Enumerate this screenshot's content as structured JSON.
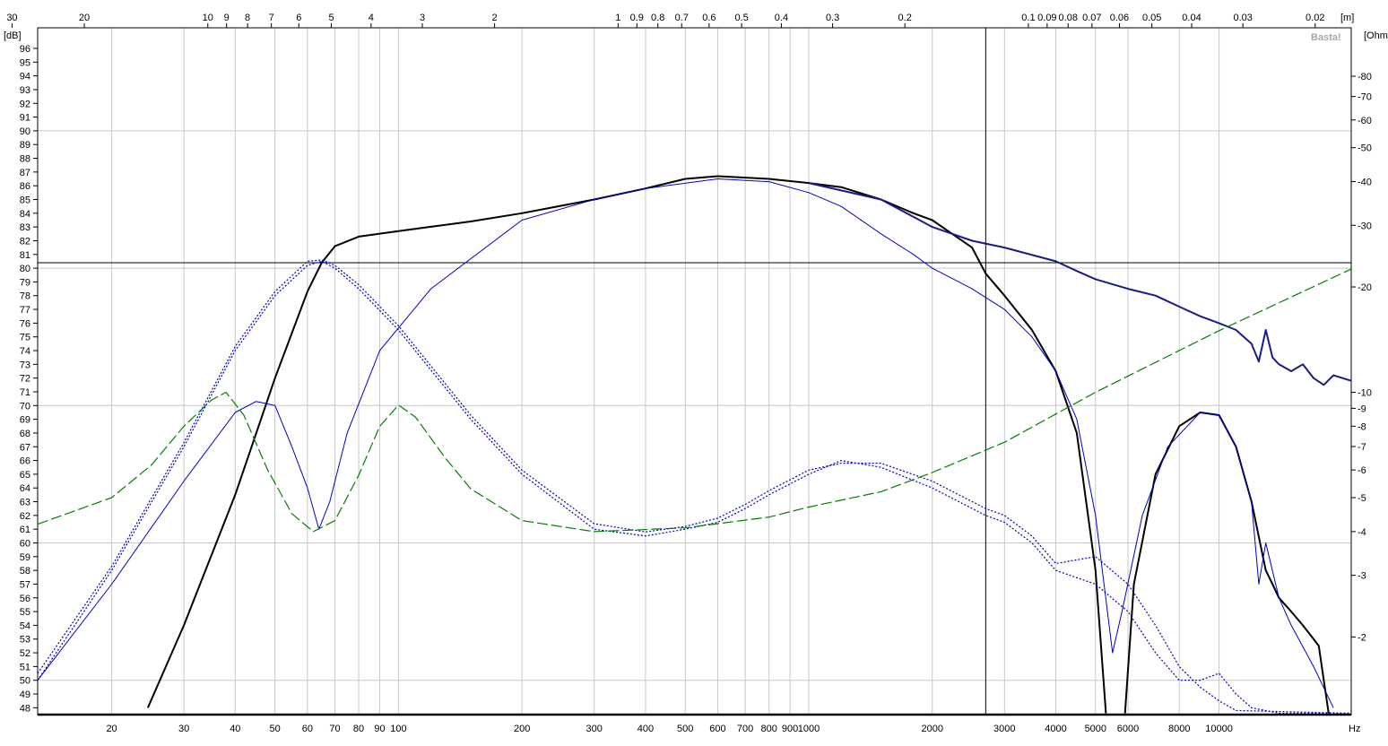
{
  "chart_data": {
    "type": "line",
    "x_scale": "log",
    "xlim": [
      13.2,
      21000
    ],
    "ylim": [
      47.5,
      97.5
    ],
    "grid": true,
    "left_axis_unit": "[dB]",
    "right_axis_unit": "[Ohm]",
    "top_axis_unit": "[m]",
    "bottom_axis_unit": "Hz",
    "watermark": "Basta!",
    "left_ticks": [
      48,
      49,
      50,
      51,
      52,
      53,
      54,
      55,
      56,
      57,
      58,
      59,
      60,
      61,
      62,
      63,
      64,
      65,
      66,
      67,
      68,
      69,
      70,
      71,
      72,
      73,
      74,
      75,
      76,
      77,
      78,
      79,
      80,
      81,
      82,
      83,
      84,
      85,
      86,
      87,
      88,
      89,
      90,
      91,
      92,
      93,
      94,
      95,
      96
    ],
    "right_ticks": [
      2,
      3,
      4,
      5,
      6,
      7,
      8,
      9,
      10,
      20,
      30,
      40,
      50,
      60,
      70,
      80
    ],
    "right_ohm_range": [
      1.2,
      110
    ],
    "bottom_ticks": [
      {
        "f": 20,
        "label": "20"
      },
      {
        "f": 30,
        "label": "30"
      },
      {
        "f": 40,
        "label": "40"
      },
      {
        "f": 50,
        "label": "50"
      },
      {
        "f": 60,
        "label": "60"
      },
      {
        "f": 70,
        "label": "70"
      },
      {
        "f": 80,
        "label": "80"
      },
      {
        "f": 90,
        "label": "90"
      },
      {
        "f": 100,
        "label": "100"
      },
      {
        "f": 200,
        "label": "200"
      },
      {
        "f": 300,
        "label": "300"
      },
      {
        "f": 400,
        "label": "400"
      },
      {
        "f": 500,
        "label": "500"
      },
      {
        "f": 600,
        "label": "600"
      },
      {
        "f": 700,
        "label": "700"
      },
      {
        "f": 800,
        "label": "800"
      },
      {
        "f": 900,
        "label": "900"
      },
      {
        "f": 1000,
        "label": "1000"
      },
      {
        "f": 2000,
        "label": "2000"
      },
      {
        "f": 3000,
        "label": "3000"
      },
      {
        "f": 4000,
        "label": "4000"
      },
      {
        "f": 5000,
        "label": "5000"
      },
      {
        "f": 6000,
        "label": "6000"
      },
      {
        "f": 8000,
        "label": "8000"
      },
      {
        "f": 10000,
        "label": "10000"
      }
    ],
    "top_ticks": [
      {
        "m": 30,
        "label": "30"
      },
      {
        "m": 20,
        "label": "20"
      },
      {
        "m": 10,
        "label": "10"
      },
      {
        "m": 9,
        "label": "9"
      },
      {
        "m": 8,
        "label": "8"
      },
      {
        "m": 7,
        "label": "7"
      },
      {
        "m": 6,
        "label": "6"
      },
      {
        "m": 5,
        "label": "5"
      },
      {
        "m": 4,
        "label": "4"
      },
      {
        "m": 3,
        "label": "3"
      },
      {
        "m": 2,
        "label": "2"
      },
      {
        "m": 1,
        "label": "1"
      },
      {
        "m": 0.9,
        "label": "0.9"
      },
      {
        "m": 0.8,
        "label": "0.8"
      },
      {
        "m": 0.7,
        "label": "0.7"
      },
      {
        "m": 0.6,
        "label": "0.6"
      },
      {
        "m": 0.5,
        "label": "0.5"
      },
      {
        "m": 0.4,
        "label": "0.4"
      },
      {
        "m": 0.3,
        "label": "0.3"
      },
      {
        "m": 0.2,
        "label": "0.2"
      },
      {
        "m": 0.1,
        "label": "0.1"
      },
      {
        "m": 0.09,
        "label": "0.09"
      },
      {
        "m": 0.08,
        "label": "0.08"
      },
      {
        "m": 0.07,
        "label": "0.07"
      },
      {
        "m": 0.06,
        "label": "0.06"
      },
      {
        "m": 0.05,
        "label": "0.05"
      },
      {
        "m": 0.04,
        "label": "0.04"
      },
      {
        "m": 0.03,
        "label": "0.03"
      },
      {
        "m": 0.02,
        "label": "0.02"
      }
    ],
    "cursor": {
      "f": 2700,
      "db": 80.4
    },
    "series": [
      {
        "color": "#000000",
        "style": "solid",
        "width": 2,
        "points": [
          [
            24.5,
            48
          ],
          [
            30,
            54
          ],
          [
            40,
            63.5
          ],
          [
            50,
            72
          ],
          [
            60,
            78.3
          ],
          [
            65,
            80.4
          ],
          [
            70,
            81.6
          ],
          [
            80,
            82.3
          ],
          [
            100,
            82.7
          ],
          [
            150,
            83.4
          ],
          [
            200,
            84
          ],
          [
            300,
            85
          ],
          [
            400,
            85.8
          ],
          [
            500,
            86.5
          ],
          [
            600,
            86.7
          ],
          [
            800,
            86.5
          ],
          [
            1000,
            86.2
          ],
          [
            1200,
            85.9
          ],
          [
            1500,
            85
          ],
          [
            1800,
            84
          ],
          [
            2000,
            83.5
          ],
          [
            2500,
            81.5
          ],
          [
            2700,
            79.6
          ],
          [
            3000,
            78
          ],
          [
            3500,
            75.5
          ],
          [
            4000,
            72.5
          ],
          [
            4500,
            68
          ],
          [
            5000,
            58
          ],
          [
            5300,
            47.6
          ]
        ]
      },
      {
        "color": "#000000",
        "style": "solid",
        "width": 2,
        "points": [
          [
            5900,
            47.6
          ],
          [
            6200,
            57
          ],
          [
            7000,
            65
          ],
          [
            8000,
            68.5
          ],
          [
            9000,
            69.5
          ],
          [
            10000,
            69.3
          ],
          [
            11000,
            67
          ],
          [
            12000,
            63
          ],
          [
            13000,
            58
          ],
          [
            13500,
            57
          ],
          [
            14000,
            56
          ],
          [
            15000,
            55
          ],
          [
            16000,
            54
          ],
          [
            17000,
            53
          ],
          [
            17500,
            52.5
          ],
          [
            18000,
            50
          ],
          [
            18500,
            47.6
          ]
        ]
      },
      {
        "color": "#1a1a8a",
        "style": "solid",
        "width": 2,
        "points": [
          [
            1000,
            86.2
          ],
          [
            1500,
            85
          ],
          [
            2000,
            83
          ],
          [
            2500,
            82
          ],
          [
            3000,
            81.5
          ],
          [
            4000,
            80.5
          ],
          [
            4500,
            79.8
          ],
          [
            5000,
            79.2
          ],
          [
            6000,
            78.5
          ],
          [
            7000,
            78
          ],
          [
            8000,
            77.2
          ],
          [
            9000,
            76.5
          ],
          [
            10000,
            76
          ],
          [
            11000,
            75.5
          ],
          [
            12000,
            74.5
          ],
          [
            12500,
            73.2
          ],
          [
            13000,
            75.5
          ],
          [
            13500,
            73.5
          ],
          [
            14000,
            73
          ],
          [
            15000,
            72.5
          ],
          [
            16000,
            73
          ],
          [
            17000,
            72
          ],
          [
            18000,
            71.5
          ],
          [
            19000,
            72.2
          ],
          [
            21000,
            71.8
          ]
        ]
      },
      {
        "color": "#0000cc",
        "style": "solid",
        "width": 1,
        "points": [
          [
            13.2,
            50
          ],
          [
            20,
            57
          ],
          [
            30,
            64.5
          ],
          [
            40,
            69.5
          ],
          [
            45,
            70.3
          ],
          [
            50,
            70
          ],
          [
            55,
            67
          ],
          [
            60,
            64
          ],
          [
            64,
            61
          ],
          [
            68,
            63
          ],
          [
            75,
            68
          ],
          [
            90,
            74
          ],
          [
            120,
            78.5
          ],
          [
            200,
            83.5
          ],
          [
            300,
            85
          ],
          [
            400,
            85.8
          ],
          [
            600,
            86.5
          ],
          [
            800,
            86.3
          ],
          [
            1000,
            85.5
          ],
          [
            1200,
            84.5
          ],
          [
            1500,
            82.5
          ],
          [
            1800,
            81
          ],
          [
            2000,
            80
          ],
          [
            2500,
            78.5
          ],
          [
            3000,
            77
          ],
          [
            3500,
            75
          ],
          [
            4000,
            72.5
          ],
          [
            4500,
            69
          ],
          [
            5000,
            62
          ],
          [
            5500,
            52
          ],
          [
            5800,
            55
          ],
          [
            6500,
            62
          ],
          [
            7500,
            67
          ],
          [
            9000,
            69.5
          ],
          [
            10000,
            69.3
          ],
          [
            11000,
            67
          ],
          [
            12000,
            63
          ],
          [
            12500,
            57
          ],
          [
            13000,
            60
          ],
          [
            14000,
            56
          ],
          [
            15000,
            54
          ],
          [
            17000,
            51
          ],
          [
            19000,
            48
          ]
        ]
      },
      {
        "color": "#0000cc",
        "style": "dotted",
        "width": 1.2,
        "points": [
          [
            13.2,
            50
          ],
          [
            20,
            58
          ],
          [
            30,
            67
          ],
          [
            40,
            74
          ],
          [
            50,
            78
          ],
          [
            60,
            80.2
          ],
          [
            65,
            80.5
          ],
          [
            70,
            80
          ],
          [
            80,
            78.5
          ],
          [
            100,
            75.5
          ],
          [
            150,
            69
          ],
          [
            200,
            65
          ],
          [
            300,
            61
          ],
          [
            400,
            60.5
          ],
          [
            500,
            61
          ],
          [
            600,
            61.5
          ],
          [
            700,
            62.5
          ],
          [
            800,
            63.5
          ],
          [
            1000,
            65
          ],
          [
            1200,
            66
          ],
          [
            1500,
            65.5
          ],
          [
            2000,
            64
          ],
          [
            2700,
            62
          ],
          [
            3000,
            61.5
          ],
          [
            3500,
            60
          ],
          [
            4000,
            58
          ],
          [
            5000,
            57
          ],
          [
            6000,
            55
          ],
          [
            7000,
            52
          ],
          [
            8000,
            50
          ],
          [
            9000,
            50
          ],
          [
            10000,
            50.5
          ],
          [
            11000,
            49
          ],
          [
            12000,
            48
          ],
          [
            14000,
            47.6
          ],
          [
            21000,
            47.6
          ]
        ]
      },
      {
        "color": "#0000cc",
        "style": "dotted",
        "width": 1.2,
        "points": [
          [
            13.2,
            50.5
          ],
          [
            20,
            58.3
          ],
          [
            30,
            67.3
          ],
          [
            40,
            74.3
          ],
          [
            50,
            78.3
          ],
          [
            60,
            80.5
          ],
          [
            65,
            80.6
          ],
          [
            70,
            80.2
          ],
          [
            80,
            78.8
          ],
          [
            100,
            75.8
          ],
          [
            150,
            69.3
          ],
          [
            200,
            65.3
          ],
          [
            300,
            61.4
          ],
          [
            400,
            60.8
          ],
          [
            500,
            61.2
          ],
          [
            600,
            61.8
          ],
          [
            700,
            62.8
          ],
          [
            800,
            63.8
          ],
          [
            1000,
            65.3
          ],
          [
            1200,
            65.8
          ],
          [
            1500,
            65.8
          ],
          [
            2000,
            64.5
          ],
          [
            2700,
            62.5
          ],
          [
            3000,
            62
          ],
          [
            3500,
            60.5
          ],
          [
            4000,
            58.5
          ],
          [
            5000,
            59
          ],
          [
            6000,
            57
          ],
          [
            7000,
            54
          ],
          [
            8000,
            51
          ],
          [
            9000,
            49.5
          ],
          [
            10000,
            48.5
          ],
          [
            11000,
            47.8
          ],
          [
            21000,
            47.6
          ]
        ]
      },
      {
        "color": "#008000",
        "style": "dashed",
        "width": 1.2,
        "ohm": true,
        "points": [
          [
            13.2,
            4.2
          ],
          [
            20,
            5
          ],
          [
            25,
            6.2
          ],
          [
            30,
            8
          ],
          [
            35,
            9.5
          ],
          [
            38,
            10
          ],
          [
            42,
            8.6
          ],
          [
            48,
            6
          ],
          [
            55,
            4.5
          ],
          [
            62,
            4.0
          ],
          [
            70,
            4.3
          ],
          [
            80,
            5.8
          ],
          [
            90,
            8
          ],
          [
            100,
            9.2
          ],
          [
            110,
            8.5
          ],
          [
            130,
            6.5
          ],
          [
            150,
            5.3
          ],
          [
            200,
            4.3
          ],
          [
            300,
            4.0
          ],
          [
            500,
            4.1
          ],
          [
            800,
            4.4
          ],
          [
            1000,
            4.7
          ],
          [
            1500,
            5.2
          ],
          [
            2000,
            5.9
          ],
          [
            3000,
            7.2
          ],
          [
            5000,
            10
          ],
          [
            10000,
            15
          ],
          [
            21000,
            22.5
          ]
        ]
      }
    ]
  }
}
